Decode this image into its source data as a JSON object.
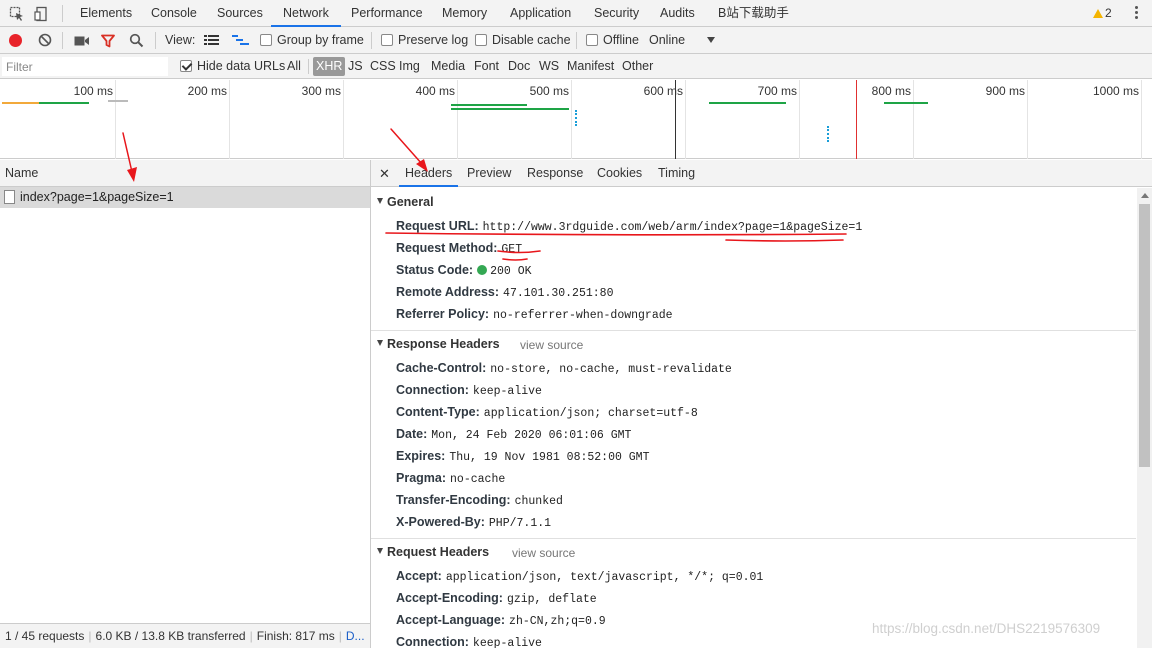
{
  "tabs": [
    {
      "label": "Elements"
    },
    {
      "label": "Console"
    },
    {
      "label": "Sources"
    },
    {
      "label": "Network"
    },
    {
      "label": "Performance"
    },
    {
      "label": "Memory"
    },
    {
      "label": "Application"
    },
    {
      "label": "Security"
    },
    {
      "label": "Audits"
    },
    {
      "label": "B站下载助手"
    }
  ],
  "active_tab": "Network",
  "warnings_count": "2",
  "toolbar": {
    "view_label": "View:",
    "group_by_frame": "Group by frame",
    "preserve_log": "Preserve log",
    "disable_cache": "Disable cache",
    "offline": "Offline",
    "throttle": "Online"
  },
  "filter": {
    "placeholder": "Filter",
    "hide_data_urls": "Hide data URLs",
    "types": [
      "All",
      "XHR",
      "JS",
      "CSS",
      "Img",
      "Media",
      "Font",
      "Doc",
      "WS",
      "Manifest",
      "Other"
    ],
    "active_type": "XHR"
  },
  "overview": {
    "ticks": [
      "100 ms",
      "200 ms",
      "300 ms",
      "400 ms",
      "500 ms",
      "600 ms",
      "700 ms",
      "800 ms",
      "900 ms",
      "1000 ms"
    ]
  },
  "requests": {
    "name_header": "Name",
    "rows": [
      {
        "name": "index?page=1&pageSize=1"
      }
    ]
  },
  "statusbar": {
    "requests": "1 / 45 requests",
    "transferred": "6.0 KB / 13.8 KB transferred",
    "finish": "Finish: 817 ms",
    "dom": "D..."
  },
  "detail_tabs": [
    "Headers",
    "Preview",
    "Response",
    "Cookies",
    "Timing"
  ],
  "active_detail_tab": "Headers",
  "general": {
    "title": "General",
    "rows": [
      {
        "key": "Request URL:",
        "value": "http://www.3rdguide.com/web/arm/index?page=1&pageSize=1"
      },
      {
        "key": "Request Method:",
        "value": "GET"
      },
      {
        "key": "Status Code:",
        "value": "200 OK"
      },
      {
        "key": "Remote Address:",
        "value": "47.101.30.251:80"
      },
      {
        "key": "Referrer Policy:",
        "value": "no-referrer-when-downgrade"
      }
    ]
  },
  "response_headers": {
    "title": "Response Headers",
    "view_source": "view source",
    "rows": [
      {
        "key": "Cache-Control:",
        "value": "no-store, no-cache, must-revalidate"
      },
      {
        "key": "Connection:",
        "value": "keep-alive"
      },
      {
        "key": "Content-Type:",
        "value": "application/json; charset=utf-8"
      },
      {
        "key": "Date:",
        "value": "Mon, 24 Feb 2020 06:01:06 GMT"
      },
      {
        "key": "Expires:",
        "value": "Thu, 19 Nov 1981 08:52:00 GMT"
      },
      {
        "key": "Pragma:",
        "value": "no-cache"
      },
      {
        "key": "Transfer-Encoding:",
        "value": "chunked"
      },
      {
        "key": "X-Powered-By:",
        "value": "PHP/7.1.1"
      }
    ]
  },
  "request_headers": {
    "title": "Request Headers",
    "view_source": "view source",
    "rows": [
      {
        "key": "Accept:",
        "value": "application/json, text/javascript, */*; q=0.01"
      },
      {
        "key": "Accept-Encoding:",
        "value": "gzip, deflate"
      },
      {
        "key": "Accept-Language:",
        "value": "zh-CN,zh;q=0.9"
      },
      {
        "key": "Connection:",
        "value": "keep-alive"
      }
    ]
  },
  "watermark": "https://blog.csdn.net/DHS2219576309",
  "colors": {
    "active_tab_underline": "#1a73e8",
    "record_red": "#e8232a",
    "filter_red": "#d93025",
    "status_green": "#34a853",
    "annotation_red": "#e8161b"
  }
}
